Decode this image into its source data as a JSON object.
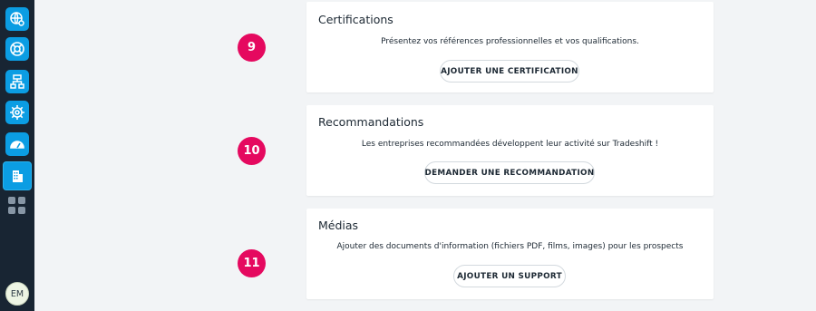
{
  "sidebar": {
    "icons": [
      "globe-settings-icon",
      "lifebuoy-icon",
      "hierarchy-icon",
      "gear-icon",
      "speedometer-icon",
      "company-building-icon",
      "apps-grid-icon"
    ],
    "avatar_initials": "EM",
    "accent": "#0b9de3"
  },
  "sections": [
    {
      "step": "9",
      "title": "Certifications",
      "description": "Présentez vos références professionnelles et vos qualifications.",
      "button": "AJOUTER UNE CERTIFICATION"
    },
    {
      "step": "10",
      "title": "Recommandations",
      "description": "Les entreprises recommandées développent leur activité sur Tradeshift !",
      "button": "DEMANDER UNE RECOMMANDATION"
    },
    {
      "step": "11",
      "title": "Médias",
      "description": "Ajouter des documents d'information (fichiers PDF, films, images) pour les prospects",
      "button": "AJOUTER UN SUPPORT"
    }
  ],
  "colors": {
    "step_badge": "#e5095f",
    "sidebar_bg": "#182533",
    "page_bg": "#f2f4f6"
  }
}
